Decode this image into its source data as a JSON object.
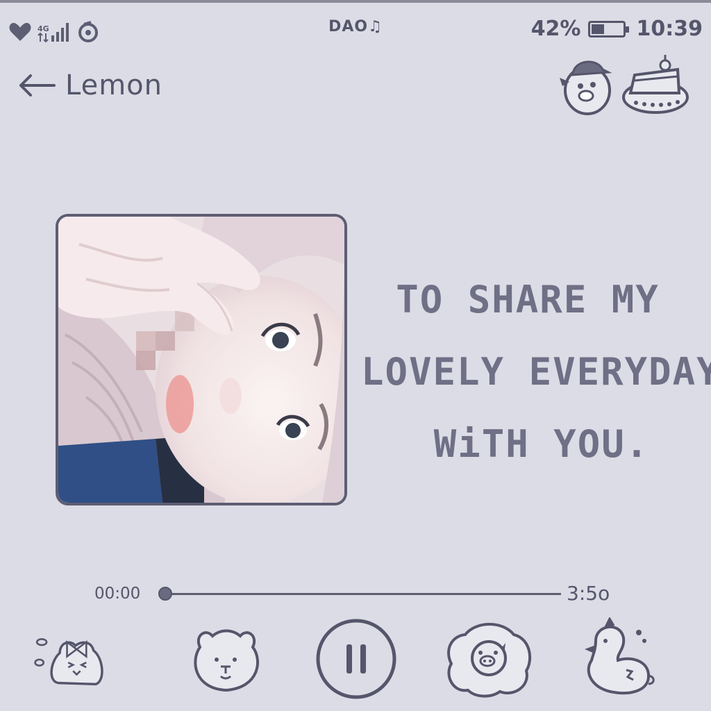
{
  "status_bar": {
    "network": "4G",
    "carrier_logo": "DAO♫",
    "battery_percent": "42%",
    "battery_level": 0.42,
    "time": "10:39"
  },
  "header": {
    "back_icon": "arrow-left-icon",
    "title": "Lemon",
    "icons": [
      "duck-hat-icon",
      "cake-slice-icon"
    ]
  },
  "album_art": {
    "description_icon": "album-cover-image"
  },
  "quote": {
    "lines": [
      "TO SHARE MY",
      "LOVELY EVERYDAY",
      "WiTH YOU."
    ]
  },
  "player": {
    "current_time": "00:00",
    "total_time": "3:5o",
    "progress": 0.0
  },
  "controls": {
    "items": [
      "bunny-bow-icon",
      "bear-icon",
      "pause-icon",
      "pig-sticker-icon",
      "chick-icon"
    ]
  },
  "colors": {
    "background": "#dcdce6",
    "ink": "#5d5d73",
    "quote_text": "#6f6f86"
  }
}
